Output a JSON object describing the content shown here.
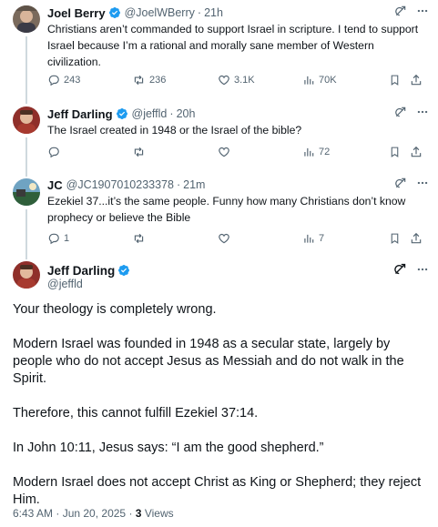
{
  "tweets": [
    {
      "name": "Joel Berry",
      "handle": "@JoelWBerry",
      "time": "21h",
      "text": "Christians aren’t commanded to support Israel in scripture. I tend to support Israel because I’m a rational and morally sane member of Western civilization.",
      "replies": "243",
      "reposts": "236",
      "likes": "3.1K",
      "views": "70K"
    },
    {
      "name": "Jeff Darling",
      "handle": "@jeffld",
      "time": "20h",
      "text": "The Israel created in 1948 or the Israel of the bible?",
      "replies": "",
      "reposts": "",
      "likes": "",
      "views": "72"
    },
    {
      "name": "JC",
      "handle": "@JC1907010233378",
      "time": "21m",
      "text": "Ezekiel 37...it’s the same people.  Funny how many Christians don’t know prophecy or believe the Bible",
      "replies": "1",
      "reposts": "",
      "likes": "",
      "views": "7"
    }
  ],
  "main_tweet": {
    "name": "Jeff Darling",
    "handle": "@jeffld",
    "paragraphs": [
      "Your theology is completely wrong.",
      "Modern Israel was founded in 1948 as a secular state, largely by people who do not accept Jesus as Messiah and do not walk in the Spirit.",
      "Therefore, this cannot fulfill Ezekiel 37:14.",
      "In John 10:11, Jesus says: “I am the good shepherd.”",
      "Modern Israel does not accept Christ as King or Shepherd; they reject Him."
    ],
    "timestamp": "6:43 AM · Jun 20, 2025",
    "separator": "·",
    "views_count": "3",
    "views_label": "Views"
  },
  "separator": "·",
  "colors": {
    "verified": "#1d9bf0",
    "muted": "#536471",
    "thread_line": "#cfd9de"
  },
  "icons": [
    "grok-icon",
    "more-icon",
    "reply-icon",
    "repost-icon",
    "like-icon",
    "views-icon",
    "bookmark-icon",
    "share-icon",
    "verified-icon"
  ]
}
